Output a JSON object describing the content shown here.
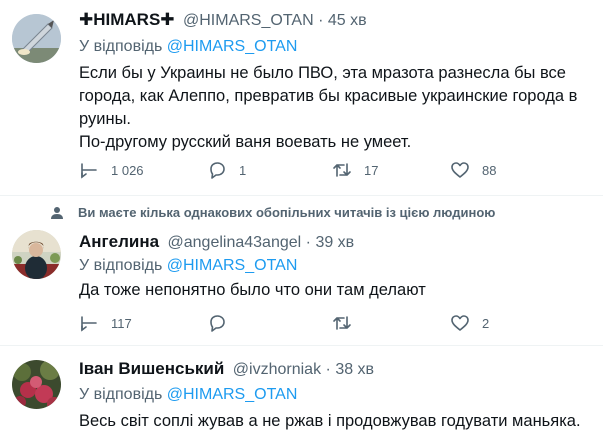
{
  "tweets": [
    {
      "name": "✚HIMARS✚",
      "handle": "@HIMARS_OTAN",
      "time": "45 хв",
      "reply_prefix": "У відповідь",
      "reply_to": "@HIMARS_OTAN",
      "lines": [
        "Если бы у Украины не было ПВО, эта мразота разнесла бы все",
        "города, как Алеппо, превратив бы красивые украинские города в",
        "руины.",
        "По-другому русский ваня воевать не умеет."
      ],
      "replies": "1 026",
      "comments": "1",
      "retweets": "17",
      "likes": "88"
    },
    {
      "name": "Ангелина",
      "handle": "@angelina43angel",
      "time": "39 хв",
      "reply_prefix": "У відповідь",
      "reply_to": "@HIMARS_OTAN",
      "lines": [
        "Да тоже непонятно было что они там делают"
      ],
      "replies": "117",
      "comments": "",
      "retweets": "",
      "likes": "2"
    },
    {
      "name": "Іван Вишенський",
      "handle": "@ivzhorniak",
      "time": "38 хв",
      "reply_prefix": "У відповідь",
      "reply_to": "@HIMARS_OTAN",
      "lines": [
        "Весь світ соплі жував а не ржав і продовжував годувати маньяка."
      ]
    }
  ],
  "notice": "Ви маєте кілька однакових обопільних читачів із цією людиною",
  "separator": "·",
  "icons": {
    "reply": "reply-icon",
    "comment": "comment-icon",
    "retweet": "retweet-icon",
    "like": "heart-icon",
    "notice": "person-icon"
  },
  "colors": {
    "accent": "#1d9bf0",
    "secondary_text": "#536471",
    "primary_text": "#0f1419"
  }
}
